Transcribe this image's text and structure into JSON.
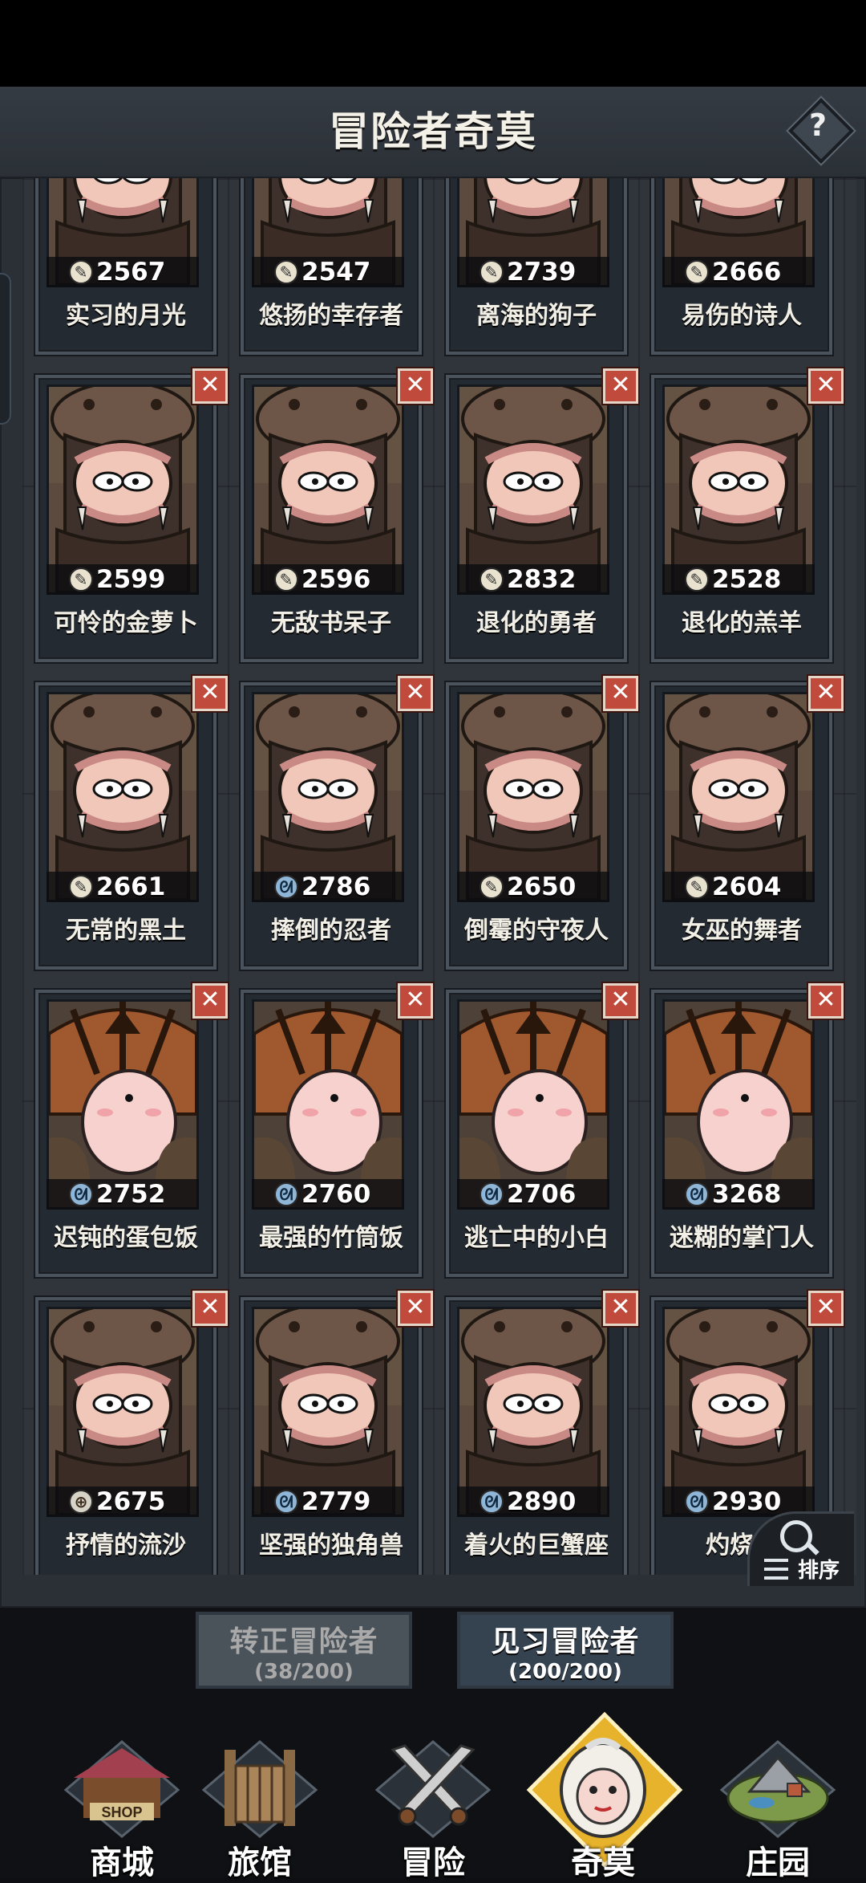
{
  "header": {
    "title": "冒险者奇莫",
    "help": "?"
  },
  "cards": [
    {
      "name": "实习的月光",
      "power": "2567",
      "class": "warrior",
      "skin": "hippo",
      "removable": false
    },
    {
      "name": "悠扬的幸存者",
      "power": "2547",
      "class": "warrior",
      "skin": "hippo",
      "removable": false
    },
    {
      "name": "离海的狗子",
      "power": "2739",
      "class": "warrior",
      "skin": "hippo",
      "removable": false
    },
    {
      "name": "易伤的诗人",
      "power": "2666",
      "class": "warrior",
      "skin": "hippo",
      "removable": false
    },
    {
      "name": "可怜的金萝卜",
      "power": "2599",
      "class": "warrior",
      "skin": "hippo",
      "removable": true
    },
    {
      "name": "无敌书呆子",
      "power": "2596",
      "class": "warrior",
      "skin": "hippo",
      "removable": true
    },
    {
      "name": "退化的勇者",
      "power": "2832",
      "class": "warrior",
      "skin": "hippo",
      "removable": true
    },
    {
      "name": "退化的羔羊",
      "power": "2528",
      "class": "warrior",
      "skin": "hippo",
      "removable": true
    },
    {
      "name": "无常的黑土",
      "power": "2661",
      "class": "warrior",
      "skin": "hippo",
      "removable": true
    },
    {
      "name": "摔倒的忍者",
      "power": "2786",
      "class": "mage",
      "skin": "hippo",
      "removable": true
    },
    {
      "name": "倒霉的守夜人",
      "power": "2650",
      "class": "warrior",
      "skin": "hippo",
      "removable": true
    },
    {
      "name": "女巫的舞者",
      "power": "2604",
      "class": "warrior",
      "skin": "hippo",
      "removable": true
    },
    {
      "name": "迟钝的蛋包饭",
      "power": "2752",
      "class": "mage",
      "skin": "helmet",
      "removable": true
    },
    {
      "name": "最强的竹筒饭",
      "power": "2760",
      "class": "mage",
      "skin": "helmet",
      "removable": true
    },
    {
      "name": "逃亡中的小白",
      "power": "2706",
      "class": "mage",
      "skin": "helmet",
      "removable": true
    },
    {
      "name": "迷糊的掌门人",
      "power": "3268",
      "class": "mage",
      "skin": "helmet",
      "removable": true
    },
    {
      "name": "抒情的流沙",
      "power": "2675",
      "class": "archer",
      "skin": "hippo",
      "removable": true
    },
    {
      "name": "坚强的独角兽",
      "power": "2779",
      "class": "mage",
      "skin": "hippo",
      "removable": true
    },
    {
      "name": "着火的巨蟹座",
      "power": "2890",
      "class": "mage",
      "skin": "hippo",
      "removable": true
    },
    {
      "name": "灼烧的",
      "power": "2930",
      "class": "mage",
      "skin": "hippo",
      "removable": true
    }
  ],
  "sort": {
    "label": "排序"
  },
  "tabs": {
    "formal": {
      "label": "转正冒险者",
      "count": "(38/200)"
    },
    "trainee": {
      "label": "见习冒险者",
      "count": "(200/200)"
    }
  },
  "nav": [
    {
      "label": "商城",
      "icon": "shop-icon",
      "sign": "SHOP"
    },
    {
      "label": "旅馆",
      "icon": "inn-gate-icon"
    },
    {
      "label": "冒险",
      "icon": "crossed-swords-icon"
    },
    {
      "label": "奇莫",
      "icon": "kimo-mascot-icon"
    },
    {
      "label": "庄园",
      "icon": "manor-island-icon"
    }
  ],
  "colors": {
    "accent": "#e8b32c",
    "remove": "#c04a3c",
    "panel": "#2b3037"
  }
}
